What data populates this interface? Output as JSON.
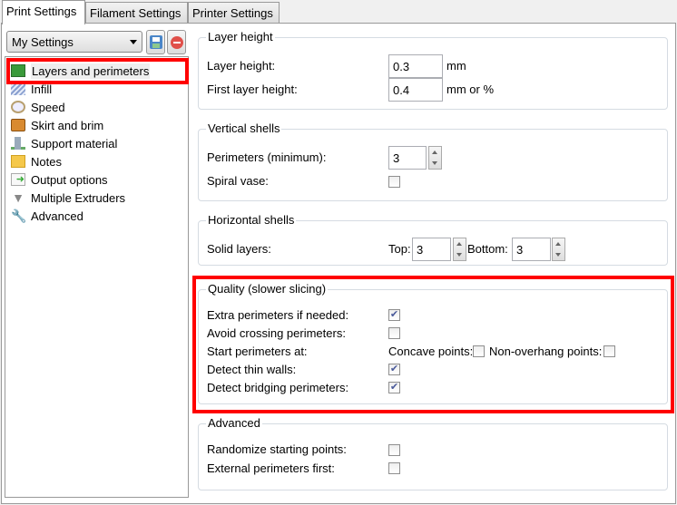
{
  "tabs": [
    "Print Settings",
    "Filament Settings",
    "Printer Settings"
  ],
  "preset": "My Settings",
  "sidebar": {
    "items": [
      {
        "label": "Layers and perimeters",
        "icon": "layers-icon"
      },
      {
        "label": "Infill",
        "icon": "infill-icon"
      },
      {
        "label": "Speed",
        "icon": "clock-icon"
      },
      {
        "label": "Skirt and brim",
        "icon": "box-icon"
      },
      {
        "label": "Support material",
        "icon": "building-icon"
      },
      {
        "label": "Notes",
        "icon": "note-icon"
      },
      {
        "label": "Output options",
        "icon": "export-icon"
      },
      {
        "label": "Multiple Extruders",
        "icon": "funnel-icon"
      },
      {
        "label": "Advanced",
        "icon": "wrench-icon"
      }
    ],
    "selected": 0
  },
  "layer_height": {
    "title": "Layer height",
    "layer_height_label": "Layer height:",
    "layer_height": "0.3",
    "layer_height_unit": "mm",
    "first_label": "First layer height:",
    "first": "0.4",
    "first_unit": "mm or %"
  },
  "vertical": {
    "title": "Vertical shells",
    "perimeters_label": "Perimeters (minimum):",
    "perimeters": "3",
    "spiral_label": "Spiral vase:",
    "spiral": false
  },
  "horizontal": {
    "title": "Horizontal shells",
    "solid_label": "Solid layers:",
    "top_label": "Top:",
    "top": "3",
    "bottom_label": "Bottom:",
    "bottom": "3"
  },
  "quality": {
    "title": "Quality (slower slicing)",
    "extra_label": "Extra perimeters if needed:",
    "extra": true,
    "avoid_label": "Avoid crossing perimeters:",
    "avoid": false,
    "start_label": "Start perimeters at:",
    "concave_label": "Concave points:",
    "concave": false,
    "overhang_label": "Non-overhang points:",
    "overhang": false,
    "thin_label": "Detect thin walls:",
    "thin": true,
    "bridging_label": "Detect bridging perimeters:",
    "bridging": true
  },
  "advanced": {
    "title": "Advanced",
    "randomize_label": "Randomize starting points:",
    "randomize": false,
    "external_label": "External perimeters first:",
    "external": false
  },
  "colors": {
    "highlight": "#ff0000"
  }
}
